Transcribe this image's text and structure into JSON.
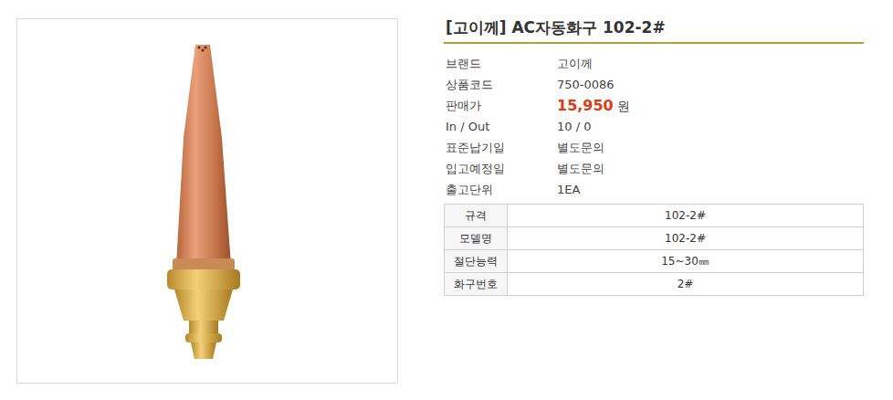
{
  "product": {
    "title": "[고이께] AC자동화구 102-2#"
  },
  "info": [
    {
      "label": "브랜드",
      "value": "고이께",
      "kind": "text"
    },
    {
      "label": "상품코드",
      "value": "750-0086",
      "kind": "text"
    },
    {
      "label": "판매가",
      "value": "15,950",
      "unit": "원",
      "kind": "price"
    },
    {
      "label": "In / Out",
      "value": "10 / 0",
      "kind": "text"
    },
    {
      "label": "표준납기일",
      "value": "별도문의",
      "kind": "text"
    },
    {
      "label": "입고예정일",
      "value": "별도문의",
      "kind": "text"
    },
    {
      "label": "출고단위",
      "value": "1EA",
      "kind": "text"
    }
  ],
  "specs": [
    {
      "label": "규격",
      "value": "102-2#"
    },
    {
      "label": "모델명",
      "value": "102-2#"
    },
    {
      "label": "절단능력",
      "value": "15~30㎜"
    },
    {
      "label": "화구번호",
      "value": "2#"
    }
  ]
}
